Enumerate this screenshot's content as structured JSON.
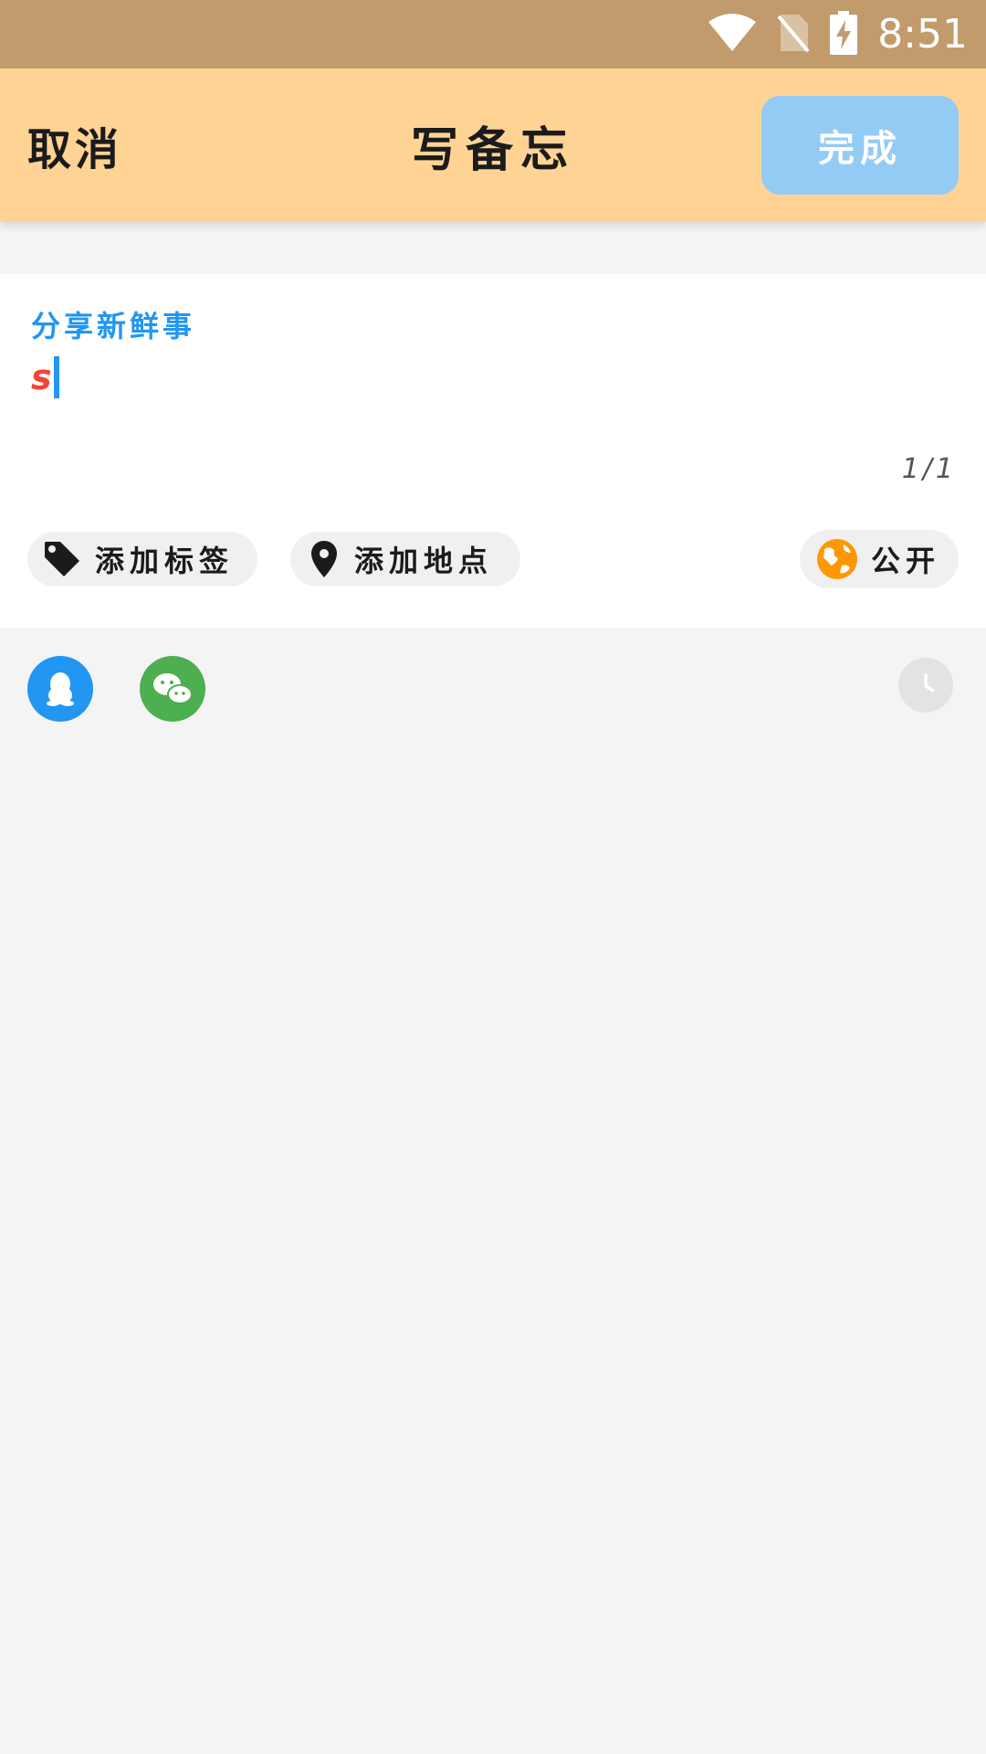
{
  "status_bar": {
    "time": "8:51",
    "icons": [
      "wifi-icon",
      "no-sim-icon",
      "battery-charging-icon"
    ]
  },
  "header": {
    "cancel_label": "取消",
    "title": "写备忘",
    "done_label": "完成"
  },
  "editor": {
    "placeholder": "分享新鲜事",
    "value": "s",
    "counter": "1/1"
  },
  "chips": {
    "tag_label": "添加标签",
    "location_label": "添加地点",
    "visibility_label": "公开"
  },
  "share": {
    "icons": [
      "qq-icon",
      "wechat-icon",
      "clock-icon"
    ]
  },
  "colors": {
    "status_bar": "#c19b6c",
    "header": "#ffd394",
    "done_button": "#93cbf4",
    "placeholder": "#2196f3",
    "input_text": "#f44336",
    "qq": "#2196f3",
    "wechat": "#4caf50",
    "globe": "#ff9800"
  }
}
